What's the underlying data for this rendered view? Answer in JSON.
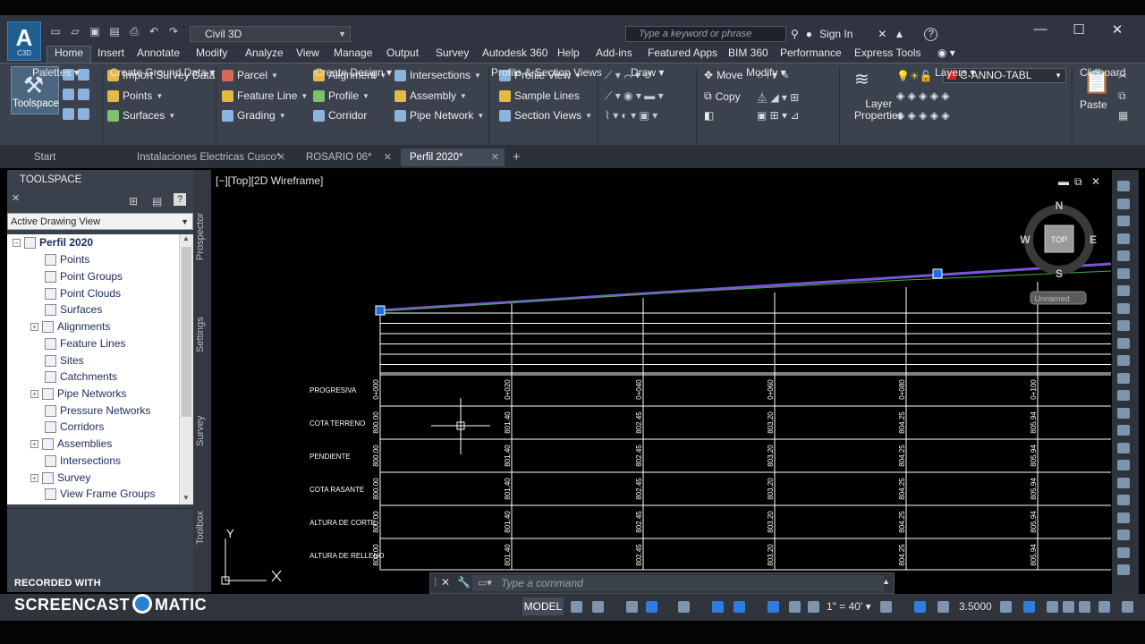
{
  "app": {
    "logo": "A",
    "logo_sub": "C3D",
    "workspace": "Civil 3D",
    "search_placeholder": "Type a keyword or phrase",
    "signin": "Sign In",
    "help": "?"
  },
  "ribbon_tabs": [
    "Home",
    "Insert",
    "Annotate",
    "Modify",
    "Analyze",
    "View",
    "Manage",
    "Output",
    "Survey",
    "Autodesk 360",
    "Help",
    "Add-ins",
    "Featured Apps",
    "BIM 360",
    "Performance",
    "Express Tools"
  ],
  "ribbon": {
    "toolspace": "Toolspace",
    "palettes": "Palettes",
    "create_ground_data": {
      "label": "Create Ground Data",
      "import_survey": "Import Survey Data",
      "points": "Points",
      "surfaces": "Surfaces"
    },
    "create_design": {
      "label": "Create Design",
      "parcel": "Parcel",
      "feature_line": "Feature Line",
      "grading": "Grading",
      "alignment": "Alignment",
      "profile": "Profile",
      "corridor": "Corridor",
      "intersections": "Intersections",
      "assembly": "Assembly",
      "pipe_network": "Pipe Network"
    },
    "profile_section": {
      "label": "Profile & Section Views",
      "profile_view": "Profile View",
      "sample_lines": "Sample Lines",
      "section_views": "Section Views"
    },
    "draw": "Draw",
    "modify": {
      "label": "Modify",
      "move": "Move",
      "copy": "Copy"
    },
    "layers": {
      "label": "Layers",
      "layer_properties_1": "Layer",
      "layer_properties_2": "Properties",
      "current_layer": "C-ANNO-TABL",
      "layer_color": "#e02020"
    },
    "clipboard": {
      "label": "Clipboard",
      "paste": "Paste"
    }
  },
  "file_tabs": [
    {
      "label": "Start",
      "closable": false
    },
    {
      "label": "Instalaciones Electricas Cusco*",
      "closable": true
    },
    {
      "label": "ROSARIO 06*",
      "closable": true
    },
    {
      "label": "Perfil 2020*",
      "closable": true,
      "active": true
    }
  ],
  "toolspace": {
    "title": "TOOLSPACE",
    "view": "Active Drawing View",
    "root": "Perfil 2020",
    "items": [
      "Points",
      "Point Groups",
      "Point Clouds",
      "Surfaces",
      "Alignments",
      "Feature Lines",
      "Sites",
      "Catchments",
      "Pipe Networks",
      "Pressure Networks",
      "Corridors",
      "Assemblies",
      "Intersections",
      "Survey",
      "View Frame Groups"
    ],
    "side_tabs": [
      "Prospector",
      "Settings",
      "Survey",
      "Toolbox"
    ]
  },
  "viewport": {
    "label": "[−][Top][2D Wireframe]",
    "viewcube": {
      "n": "N",
      "s": "S",
      "e": "E",
      "w": "W",
      "top": "TOP",
      "unnamed": "Unnamed"
    },
    "ucs_y": "Y"
  },
  "profile_table": {
    "row_labels": [
      "PROGRESIVA",
      "COTA TERRENO",
      "PENDIENTE",
      "COTA RASANTE",
      "ALTURA DE CORTE",
      "ALTURA DE RELLENO"
    ],
    "columns": [
      {
        "progresiva": "0+000",
        "terreno": "800.00",
        "pendiente": "800.00",
        "rasante": "800.00",
        "corte": "800.00",
        "relleno": "800.00"
      },
      {
        "progresiva": "0+020",
        "terreno": "801.40",
        "pendiente": "801.40",
        "rasante": "801.40",
        "corte": "801.40",
        "relleno": "801.40"
      },
      {
        "progresiva": "0+040",
        "terreno": "802.45",
        "pendiente": "802.45",
        "rasante": "802.45",
        "corte": "802.45",
        "relleno": "802.45"
      },
      {
        "progresiva": "0+060",
        "terreno": "803.20",
        "pendiente": "803.20",
        "rasante": "803.20",
        "corte": "803.20",
        "relleno": "803.20"
      },
      {
        "progresiva": "0+080",
        "terreno": "804.25",
        "pendiente": "804.25",
        "rasante": "804.25",
        "corte": "804.25",
        "relleno": "804.25"
      },
      {
        "progresiva": "0+100",
        "terreno": "805.94",
        "pendiente": "805.94",
        "rasante": "805.94",
        "corte": "805.94",
        "relleno": "805.94"
      }
    ],
    "line_color": "#7b55d8",
    "ground_color": "#3fae3f",
    "grip_color": "#1a6fe8"
  },
  "command": {
    "placeholder": "Type a command"
  },
  "status": {
    "model": "MODEL",
    "scale": "1\" = 40'",
    "value": "3.5000"
  },
  "watermark": {
    "recorded": "RECORDED WITH",
    "brand_left": "SCREENCAST",
    "brand_right": "MATIC"
  }
}
